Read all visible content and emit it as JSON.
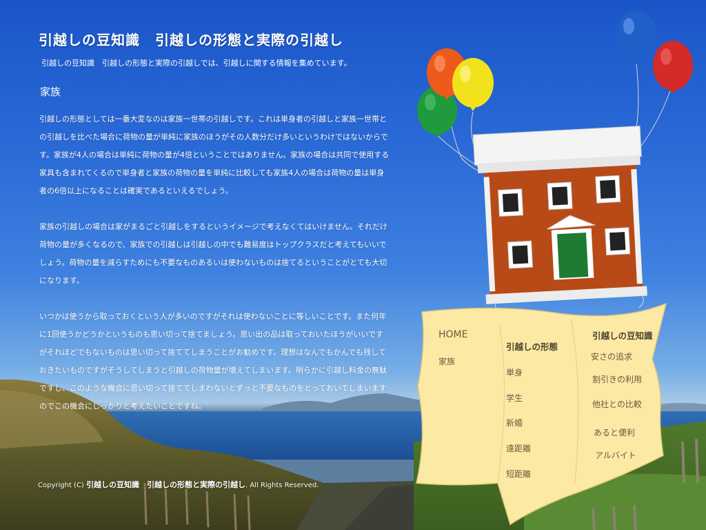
{
  "header": {
    "title_part1": "引越しの豆知識",
    "title_part2": "引越しの形態と実際の引越し",
    "description": "引越しの豆知識　引越しの形態と実際の引越しでは、引越しに関する情報を集めています。"
  },
  "page": {
    "heading": "家族",
    "paragraphs": [
      "引越しの形態としては一番大変なのは家族一世帯の引越しです。これは単身者の引越しと家族一世帯との引越しを比べた場合に荷物の量が単純に家族のほうがその人数分だけ多いというわけではないからです。家族が4人の場合は単純に荷物の量が4倍ということではありません。家族の場合は共同で使用する家具も含まれてくるので単身者と家族の荷物の量を単純に比較しても家族4人の場合は荷物の量は単身者の6倍以上になることは確実であるといえるでしょう。",
      "家族の引越しの場合は家がまるごと引越しをするというイメージで考えなくてはいけません。それだけ荷物の量が多くなるので、家族での引越しは引越しの中でも難易度はトップクラスだと考えてもいいでしょう。荷物の量を減らすためにも不要なものあるいは使わないものは捨てるということがとても大切になります。",
      "いつかは使うから取っておくという人が多いのですがそれは使わないことに等しいことです。また何年に1回使うかどうかというものも思い切って捨てましょう。思い出の品は取っておいたほうがいいですがそれほどでもないものは思い切って捨ててしまうことがお勧めです。理想はなんでもかんでも残しておきたいものですがそうしてしまうと引越しの荷物量が増えてしまいます。明らかに引越し料金の無駄ですし、このような機会に思い切って捨ててしまわないとずっと不要なものをとっておいてしまいますのでこの機会にしっかりと考えたいことですね。"
    ]
  },
  "footer": {
    "copyright": "Copyright (C)",
    "site_name": "引越しの豆知識　引越しの形態と実際の引越し",
    "rights": ". All Rights Reserved."
  },
  "menu": {
    "col1": [
      "HOME",
      "家族"
    ],
    "col2_heading": "引越しの形態",
    "col2": [
      "単身",
      "学生",
      "新婚",
      "遠距離",
      "短距離"
    ],
    "col3_heading": "引越しの豆知識",
    "col3": [
      "安さの追求",
      "割引きの利用",
      "他社との比較",
      "あると便利",
      "アルバイト"
    ]
  },
  "colors": {
    "sky": "#2a6ad6",
    "paper": "#fbe9a4",
    "brick": "#b84a18",
    "door": "#1f7a32",
    "balloon_red": "#d42a2a",
    "balloon_blue": "#1e5fc8",
    "balloon_yellow": "#f2e21c",
    "balloon_orange": "#ee5a1c",
    "balloon_green": "#1f9a3c"
  }
}
